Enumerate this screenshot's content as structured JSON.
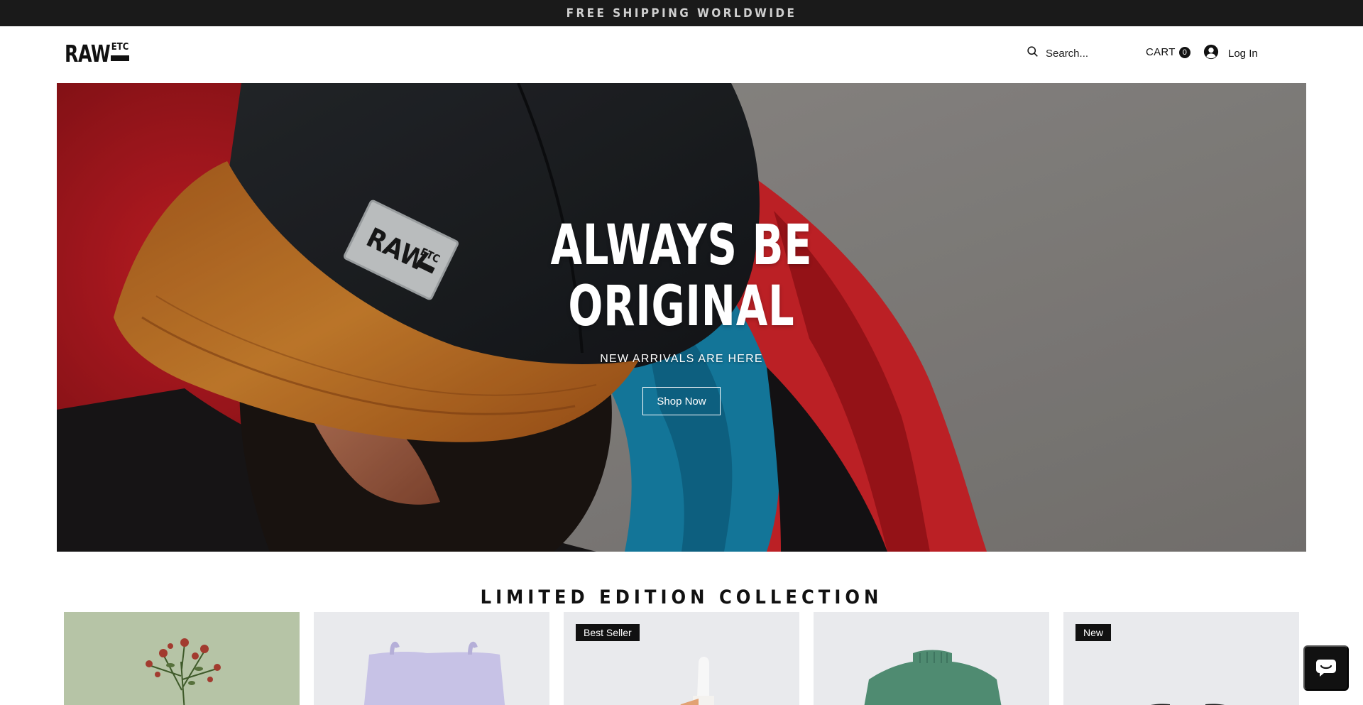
{
  "announcement": {
    "text": "FREE SHIPPING WORLDWIDE"
  },
  "header": {
    "logo": {
      "main": "RAW",
      "sup": "ETC"
    },
    "search": {
      "placeholder": "Search..."
    },
    "cart": {
      "label": "CART",
      "count": "0"
    },
    "login": {
      "label": "Log In"
    },
    "icons": [
      "search-icon",
      "avatar-icon"
    ]
  },
  "hero": {
    "title_line1": "ALWAYS BE",
    "title_line2": "ORIGINAL",
    "subtitle": "NEW ARRIVALS ARE HERE",
    "button": "Shop Now",
    "cap_patch": {
      "main": "RAW",
      "sup": "ETC"
    }
  },
  "collection": {
    "title": "LIMITED EDITION COLLECTION",
    "products": [
      {
        "badge": "",
        "thumbnail": "dried-roses-vase"
      },
      {
        "badge": "",
        "thumbnail": "lavender-tote-bag"
      },
      {
        "badge": "Best Seller",
        "thumbnail": "serum-dropper-bottle"
      },
      {
        "badge": "",
        "thumbnail": "green-knit-sweater"
      },
      {
        "badge": "New",
        "thumbnail": "dark-item"
      }
    ]
  },
  "chat": {
    "icon": "chat-bubble-icon"
  },
  "colors": {
    "topbar": "#1a1a1a",
    "text": "#111111",
    "badge": "#111111",
    "card_bg": "#e9eaed"
  }
}
